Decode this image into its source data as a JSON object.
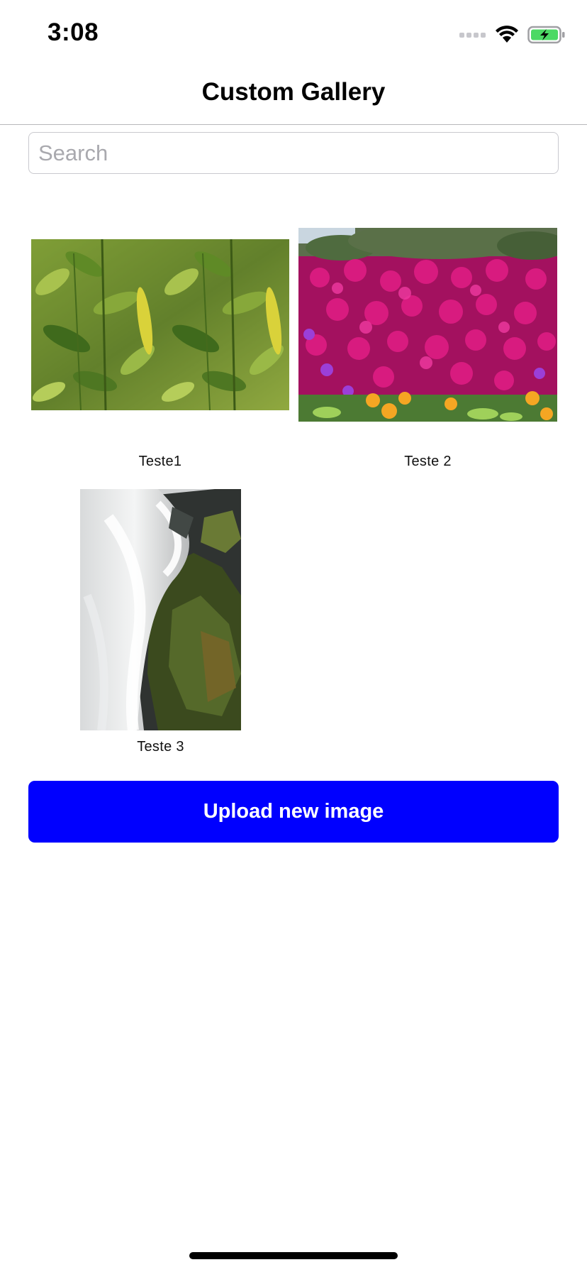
{
  "status_bar": {
    "time": "3:08",
    "icons": [
      "cellular-signal-icon",
      "wifi-icon",
      "battery-charging-icon"
    ],
    "battery_color": "#4cd964"
  },
  "nav": {
    "title": "Custom Gallery"
  },
  "search": {
    "placeholder": "Search",
    "value": ""
  },
  "gallery": {
    "items": [
      {
        "label": "Teste1",
        "image": "green-leaves-photo"
      },
      {
        "label": "Teste 2",
        "image": "magenta-flowers-photo"
      },
      {
        "label": "Teste 3",
        "image": "waterfall-photo"
      }
    ]
  },
  "actions": {
    "upload_label": "Upload new image",
    "upload_color": "#0000ff"
  }
}
